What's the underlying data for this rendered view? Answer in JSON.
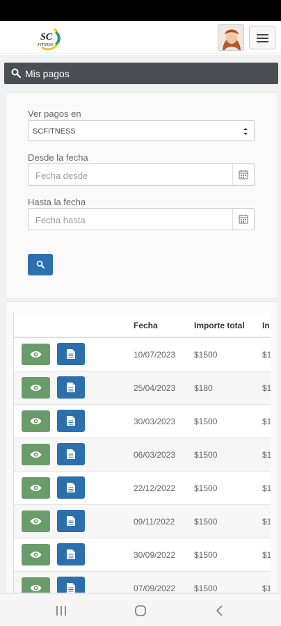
{
  "header": {
    "logo_text": "SC",
    "logo_subtext": "FITNESS"
  },
  "panel": {
    "title": "Mis pagos"
  },
  "filters": {
    "ver_pagos_label": "Ver pagos en",
    "ver_pagos_value": "SCFITNESS",
    "desde_label": "Desde la fecha",
    "desde_placeholder": "Fecha desde",
    "hasta_label": "Hasta la fecha",
    "hasta_placeholder": "Fecha hasta"
  },
  "table": {
    "headers": [
      "Fecha",
      "Importe total",
      "In"
    ],
    "rows": [
      {
        "fecha": "10/07/2023",
        "importe": "$1500",
        "extra": "$1"
      },
      {
        "fecha": "25/04/2023",
        "importe": "$180",
        "extra": "$1"
      },
      {
        "fecha": "30/03/2023",
        "importe": "$1500",
        "extra": "$1"
      },
      {
        "fecha": "06/03/2023",
        "importe": "$1500",
        "extra": "$1"
      },
      {
        "fecha": "22/12/2022",
        "importe": "$1500",
        "extra": "$1"
      },
      {
        "fecha": "09/11/2022",
        "importe": "$1500",
        "extra": "$1"
      },
      {
        "fecha": "30/09/2022",
        "importe": "$1500",
        "extra": "$1"
      },
      {
        "fecha": "07/09/2022",
        "importe": "$1500",
        "extra": "$1"
      }
    ]
  },
  "colors": {
    "header_bg": "#4b4f54",
    "primary": "#2c6fad",
    "success": "#6a9c6b"
  },
  "icons": [
    "search-icon",
    "calendar-icon",
    "eye-icon",
    "document-icon",
    "menu-icon",
    "avatar"
  ]
}
